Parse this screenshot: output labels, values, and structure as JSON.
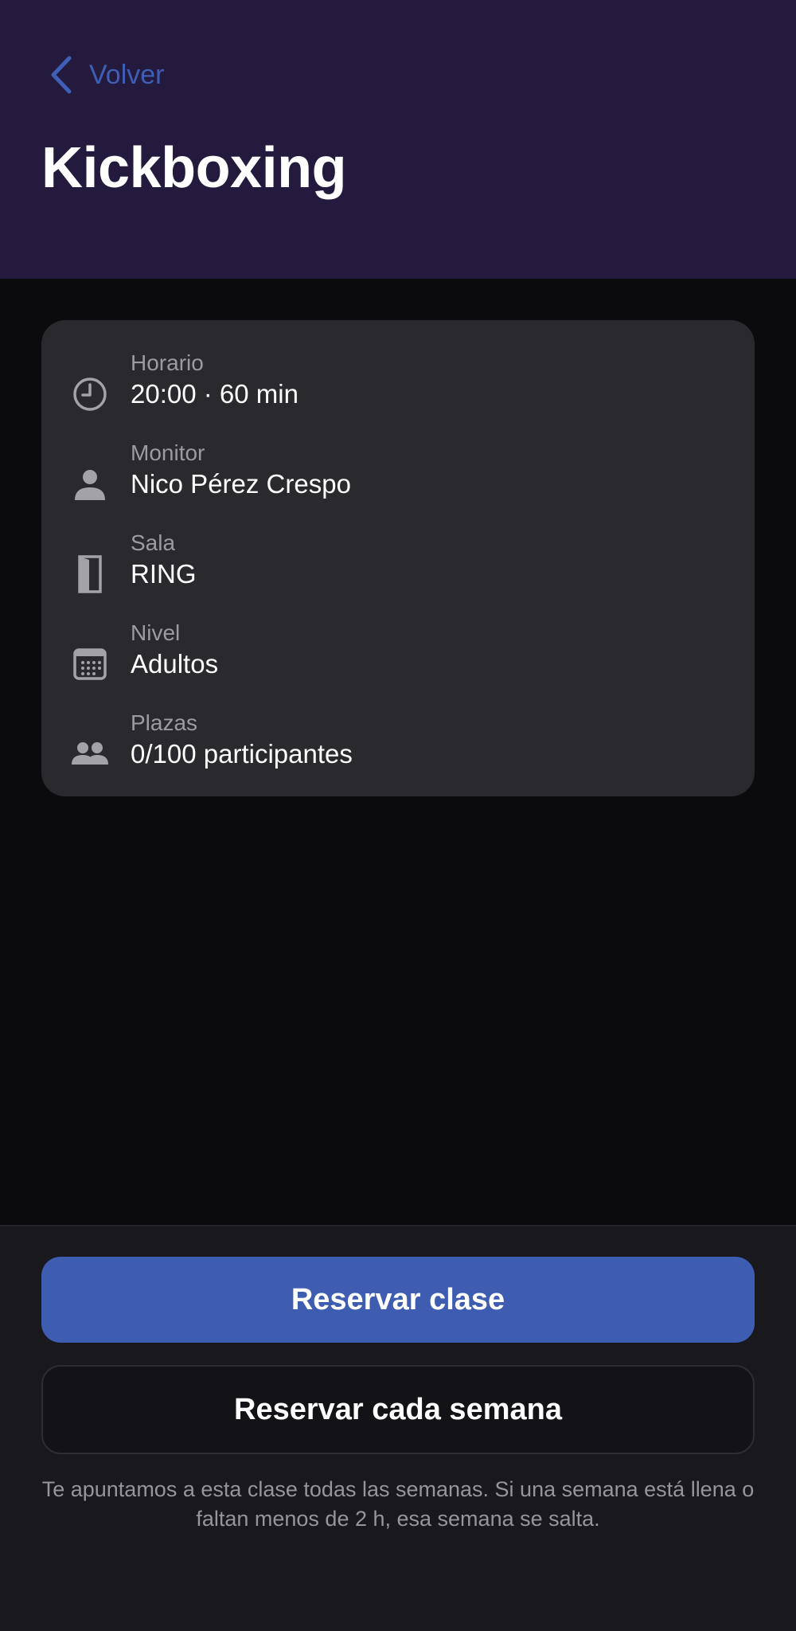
{
  "header": {
    "back_label": "Volver",
    "title": "Kickboxing"
  },
  "details": [
    {
      "icon": "clock-icon",
      "label": "Horario",
      "value": "20:00 · 60 min"
    },
    {
      "icon": "person-icon",
      "label": "Monitor",
      "value": "Nico Pérez Crespo"
    },
    {
      "icon": "door-icon",
      "label": "Sala",
      "value": "RING"
    },
    {
      "icon": "calendar-icon",
      "label": "Nivel",
      "value": "Adultos"
    },
    {
      "icon": "people-icon",
      "label": "Plazas",
      "value": "0/100 participantes"
    }
  ],
  "actions": {
    "book_label": "Reservar clase",
    "book_weekly_label": "Reservar cada semana",
    "helper_text": "Te apuntamos a esta clase todas las semanas. Si una semana está llena o faltan menos de 2 h, esa semana se salta."
  },
  "colors": {
    "header_bg": "#231a3d",
    "accent": "#3e5db0",
    "link": "#3f5fb6",
    "card_bg": "#29292e",
    "page_bg": "#0b0b0d"
  }
}
